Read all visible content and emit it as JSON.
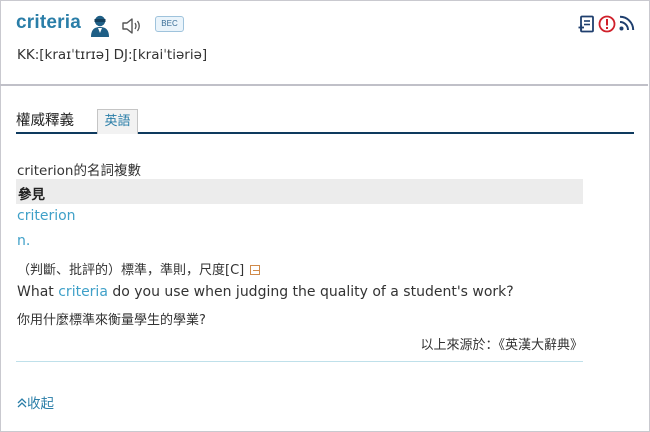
{
  "entry": {
    "word": "criteria",
    "badge": "BEC",
    "phonetic": "KK:[kraɪˈtɪrɪə] DJ:[kraiˈtiəriə]",
    "icons": [
      "user-avatar-icon",
      "speaker-icon",
      "notebook-icon",
      "report-icon",
      "rss-icon"
    ]
  },
  "tabs": {
    "main_label": "權威釋義",
    "active_tab": "英語"
  },
  "definition": {
    "plural_note": "criterion的名詞複數",
    "see_label": "參見",
    "see_word": "criterion",
    "pos": "n.",
    "sense": "（判斷、批評的）標準，準則，尺度[C]",
    "example_before": "What ",
    "example_highlight": "criteria",
    "example_after": " do you use when judging the quality of a student's work?",
    "example_translation": "你用什麼標準來衡量學生的學業?",
    "source": "以上來源於：《英漢大辭典》"
  },
  "footer": {
    "collapse_label": "收起"
  },
  "colors": {
    "accent": "#2a7ea8",
    "link": "#3fa0c8",
    "tab_rule": "#0e3a5e",
    "report_red": "#d0202a"
  }
}
